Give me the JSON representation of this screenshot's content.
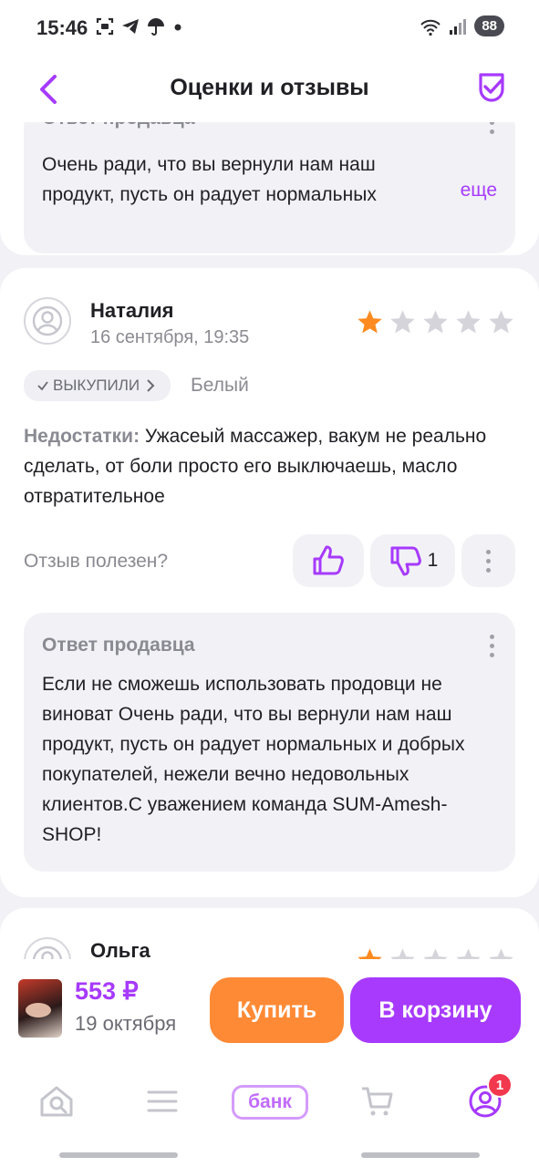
{
  "status_bar": {
    "time": "15:46",
    "battery": "88"
  },
  "header": {
    "title": "Оценки и отзывы"
  },
  "reviews": [
    {
      "seller_reply": {
        "label": "Ответ продавца",
        "text": "Очень ради, что вы вернули нам наш продукт, пусть он радует нормальных",
        "more": "еще"
      }
    },
    {
      "author": "Наталия",
      "date": "16 сентября, 19:35",
      "rating": 1,
      "max_rating": 5,
      "badge": "ВЫКУПИЛИ",
      "variant": "Белый",
      "cons_label": "Недостатки:",
      "cons_text": "Ужасеый массажер, вакум не реально сделать, от боли просто его выключаешь, масло отвратительное",
      "helpful_question": "Отзыв полезен?",
      "likes": "",
      "dislikes": "1",
      "seller_reply": {
        "label": "Ответ продавца",
        "text": "Если не сможешь использовать  продовци не виноват  Очень ради, что вы вернули нам наш продукт, пусть он радует нормальных и добрых покупателей, нежели вечно недовольных клиентов.С уважением команда  SUM-Amesh-SHOP!"
      }
    },
    {
      "author": "Ольга",
      "rating": 1,
      "max_rating": 5
    }
  ],
  "buy_bar": {
    "price": "553 ₽",
    "delivery_date": "19 октября",
    "buy_label": "Купить",
    "cart_label": "В корзину"
  },
  "tab_bar": {
    "bank_label": "банк",
    "profile_badge": "1"
  },
  "colors": {
    "accent": "#a73afd",
    "buy": "#ff8a35",
    "star_active": "#ff8a1f",
    "star_inactive": "#d4d4da",
    "badge": "#f2384e"
  }
}
